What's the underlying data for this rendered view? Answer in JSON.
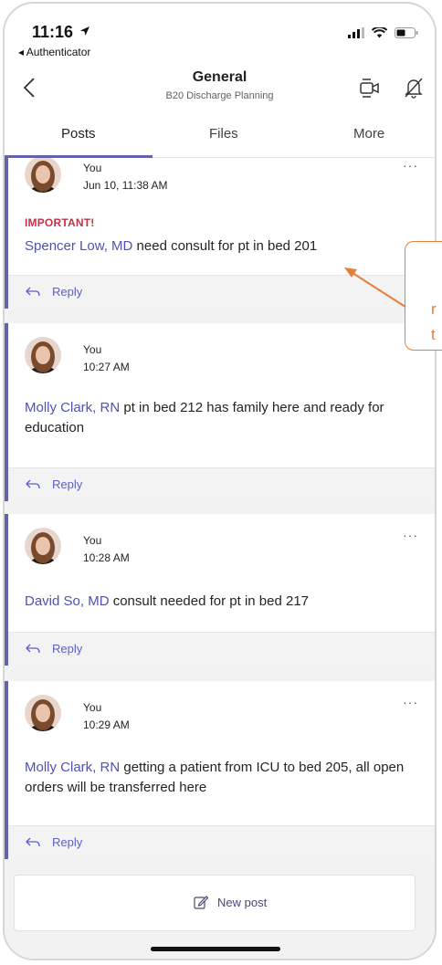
{
  "status_bar": {
    "time": "11:16",
    "back_app": "◂ Authenticator"
  },
  "header": {
    "title": "General",
    "subtitle": "B20 Discharge Planning"
  },
  "tabs": [
    {
      "label": "Posts",
      "active": true
    },
    {
      "label": "Files",
      "active": false
    },
    {
      "label": "More",
      "active": false
    }
  ],
  "posts": [
    {
      "author": "You",
      "timestamp": "Jun 10, 11:38 AM",
      "important": "IMPORTANT!",
      "mention": "Spencer Low, MD",
      "text": " need consult for pt in bed 201",
      "reply": "Reply"
    },
    {
      "author": "You",
      "timestamp": "10:27 AM",
      "mention": "Molly Clark, RN",
      "text": " pt in bed 212 has family here and ready for education",
      "reply": "Reply"
    },
    {
      "author": "You",
      "timestamp": "10:28 AM",
      "mention": "David So, MD",
      "text": " consult needed for pt in bed 217",
      "reply": "Reply"
    },
    {
      "author": "You",
      "timestamp": "10:29 AM",
      "mention": "Molly Clark, RN",
      "text": " getting a patient from ICU to bed 205, all open orders will be transferred here",
      "reply": "Reply"
    }
  ],
  "more_menu": "···",
  "callout": {
    "line1": "r",
    "line2": "t"
  },
  "new_post": {
    "label": "New post"
  },
  "colors": {
    "accent": "#6264a7",
    "mention": "#4f52b2",
    "important": "#c4314b",
    "callout": "#e67e3c"
  }
}
